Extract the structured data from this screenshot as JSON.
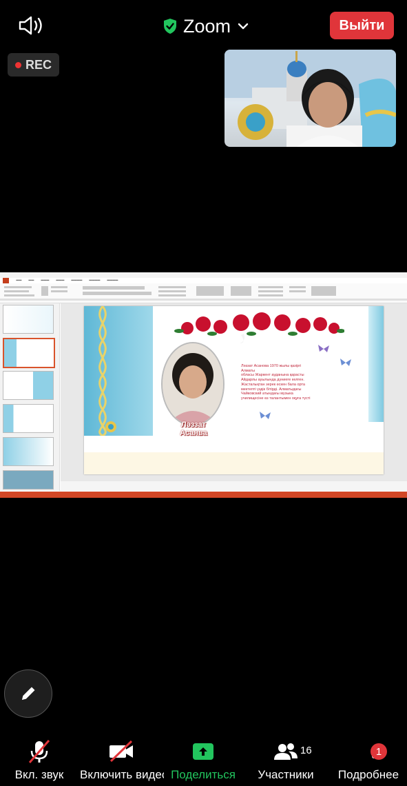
{
  "top_bar": {
    "meeting_name": "Zoom",
    "leave_label": "Выйти",
    "rec_label": "REC"
  },
  "shared_slide": {
    "name_caption_line1": "Ләззат",
    "name_caption_line2": "Асанва",
    "bio_text": "Ләззат Асанова 1970 жылы қазіргі\nАлматы\nобласы Жаркент ауданына қарасты\nАйдарлы ауылында дүниеге келген.\nЖасталықтан зерек өскен бала орта\nмектепті үздік бітірді. Алматыдағы\nЧайковский атындағы музыка\nучилищесіне өз талантымен оқуға түсті"
  },
  "bottom_bar": {
    "audio_label": "Вкл. звук",
    "video_label": "Включить видео",
    "share_label": "Поделиться",
    "participants_label": "Участники",
    "participants_count": "16",
    "more_label": "Подробнее",
    "more_badge": "1"
  },
  "colors": {
    "leave_red": "#e0353a",
    "share_green": "#22c55e",
    "shield_green": "#22c55e"
  }
}
